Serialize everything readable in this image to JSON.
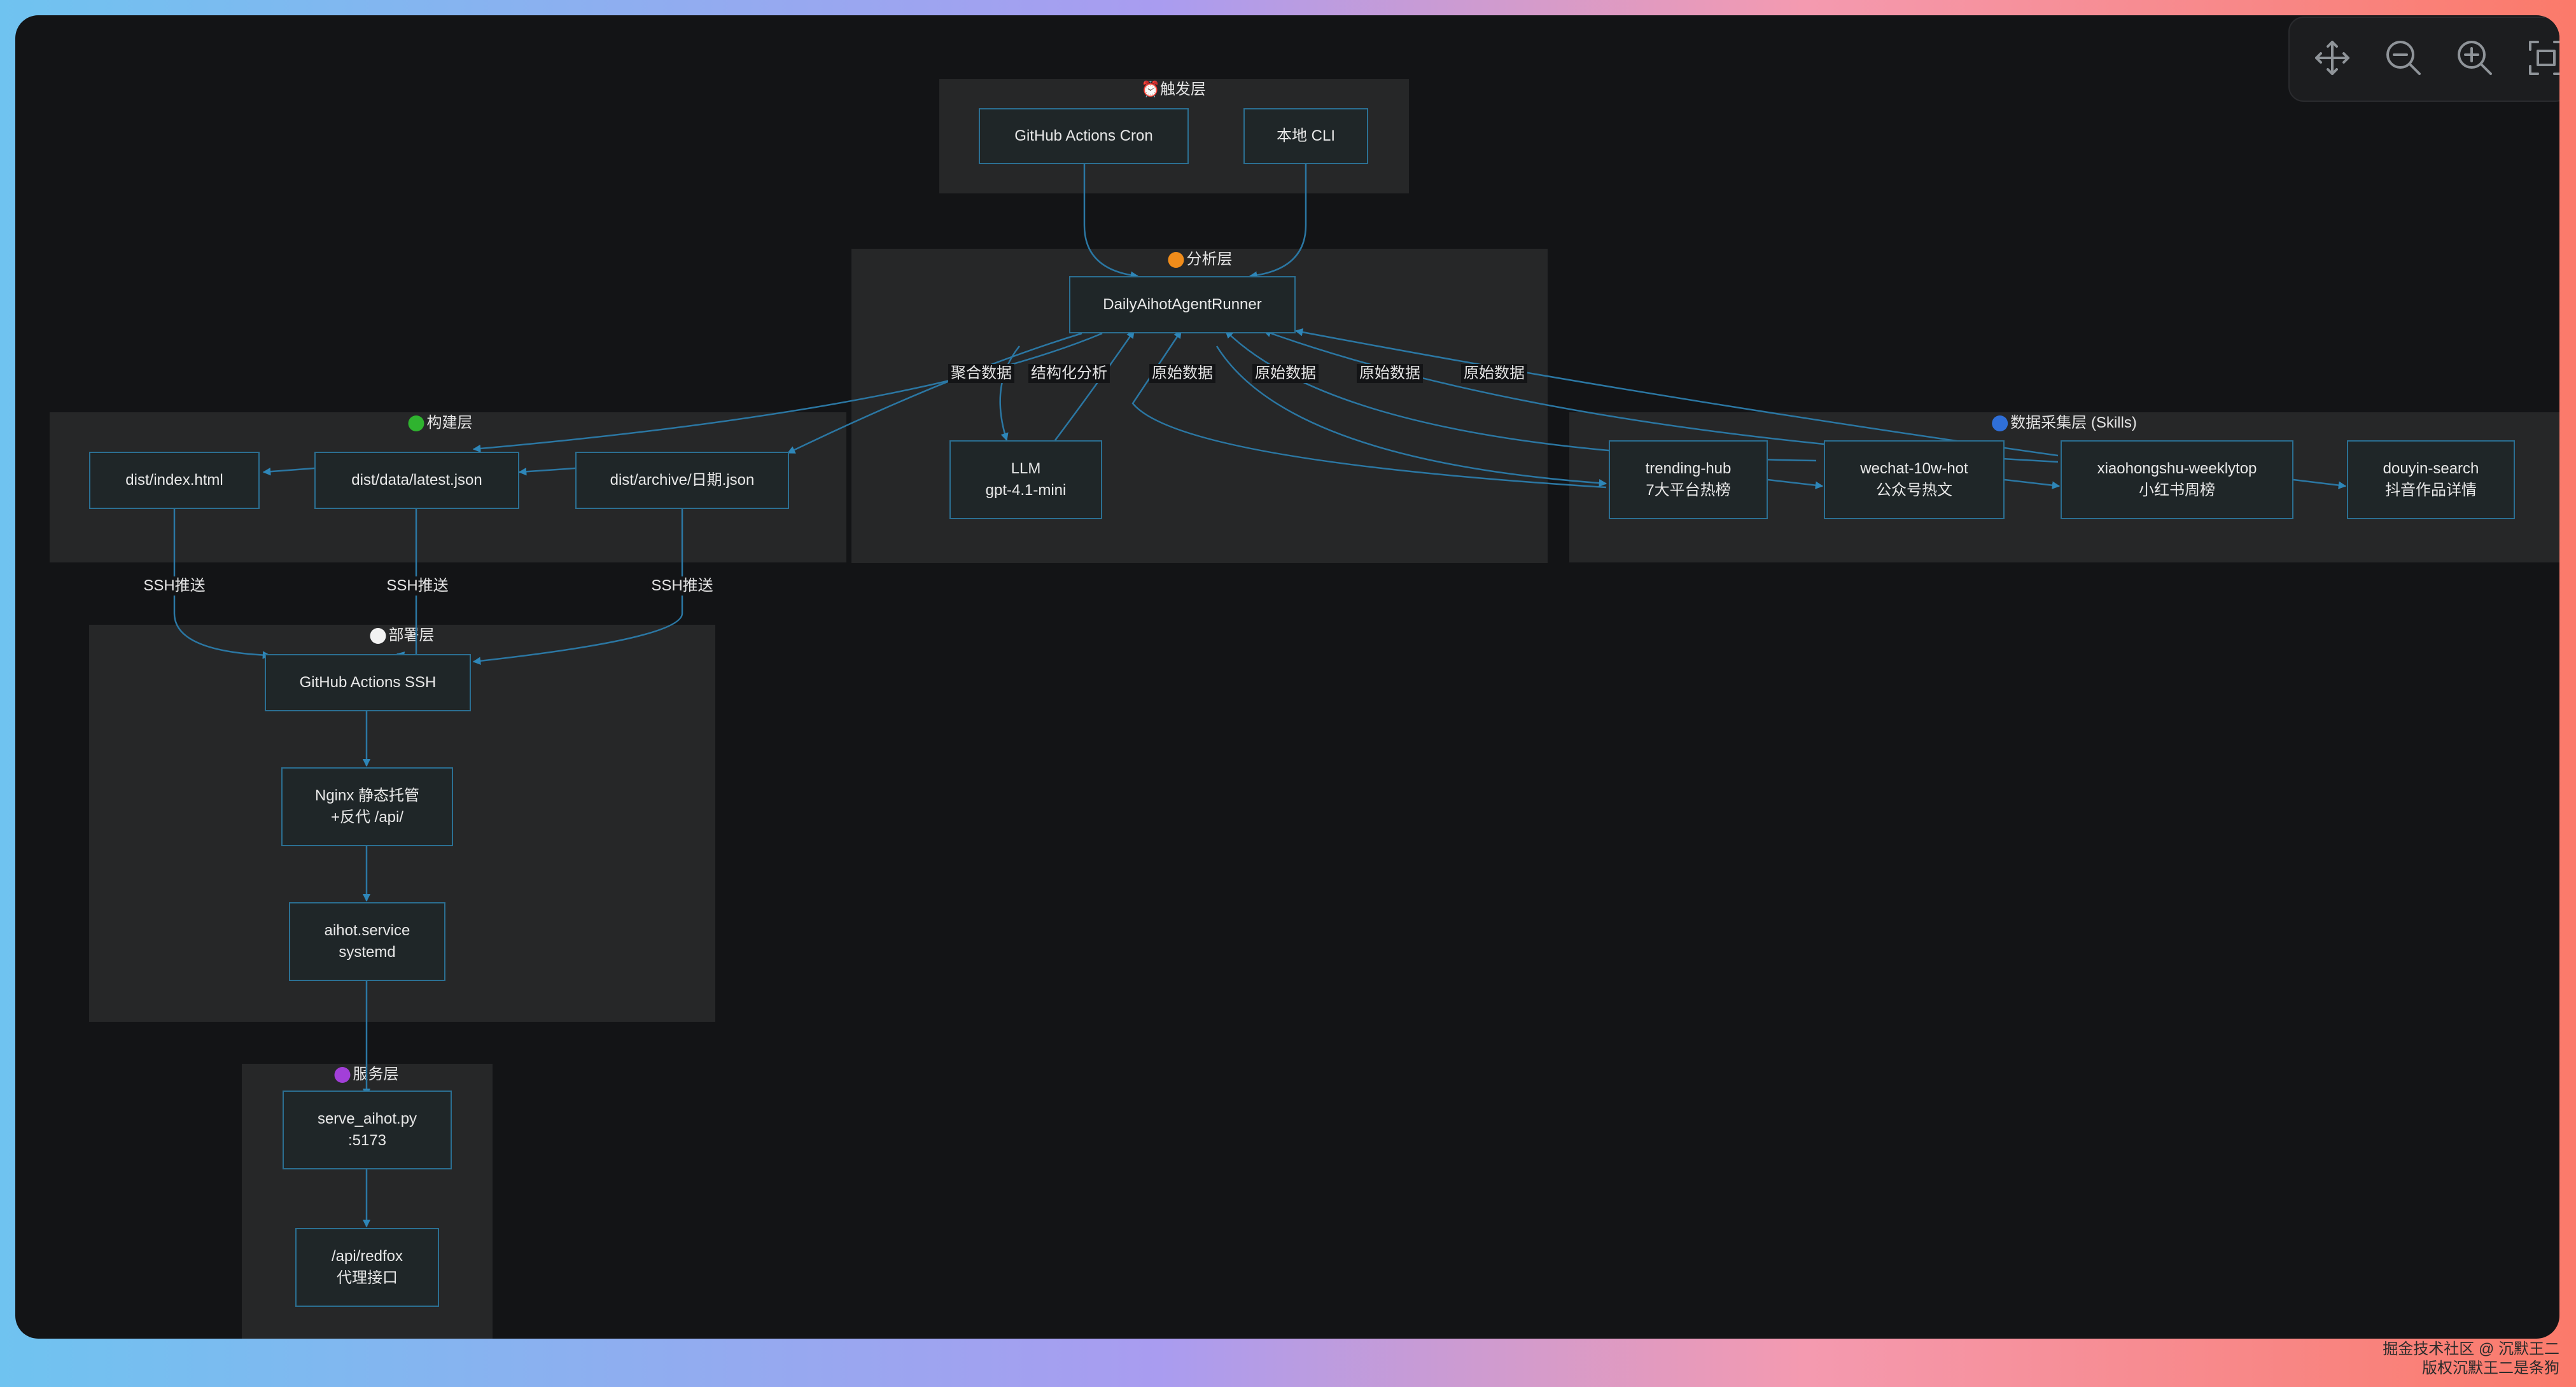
{
  "groups": {
    "trigger": "⏰触发层",
    "analysis": "分析层",
    "build": "构建层",
    "collect": "数据采集层 (Skills)",
    "deploy": "部署层",
    "service": "服务层"
  },
  "group_colors": {
    "analysis": "#f08c1a",
    "build": "#2fb32f",
    "collect": "#2f6fd8",
    "deploy": "#f2f2f2",
    "service": "#a23fd8"
  },
  "nodes": {
    "github_cron": [
      "GitHub Actions Cron"
    ],
    "local_cli": [
      "本地 CLI"
    ],
    "runner": [
      "DailyAihotAgentRunner"
    ],
    "llm": [
      "LLM",
      "gpt-4.1-mini"
    ],
    "dist_index": [
      "dist/index.html"
    ],
    "dist_latest": [
      "dist/data/latest.json"
    ],
    "dist_archive": [
      "dist/archive/日期.json"
    ],
    "trending": [
      "trending-hub",
      "7大平台热榜"
    ],
    "wechat": [
      "wechat-10w-hot",
      "公众号热文"
    ],
    "xiaohongshu": [
      "xiaohongshu-weeklytop",
      "小红书周榜"
    ],
    "douyin": [
      "douyin-search",
      "抖音作品详情"
    ],
    "gh_ssh": [
      "GitHub Actions SSH"
    ],
    "nginx": [
      "Nginx 静态托管",
      "+反代 /api/"
    ],
    "aihot_service": [
      "aihot.service",
      "systemd"
    ],
    "serve_py": [
      "serve_aihot.py",
      ":5173"
    ],
    "api_redfox": [
      "/api/redfox",
      "代理接口"
    ]
  },
  "edge_labels": {
    "aggregate": "聚合数据",
    "structured": "结构化分析",
    "raw1": "原始数据",
    "raw2": "原始数据",
    "raw3": "原始数据",
    "raw4": "原始数据",
    "ssh1": "SSH推送",
    "ssh2": "SSH推送",
    "ssh3": "SSH推送"
  },
  "toolbar": {
    "move_icon": "move-icon",
    "zoom_out_icon": "zoom-out-icon",
    "zoom_in_icon": "zoom-in-icon",
    "fit_icon": "fit-screen-icon"
  },
  "footer": {
    "line1": "掘金技术社区 @ 沉默王二",
    "line2": "版权沉默王二是条狗"
  }
}
